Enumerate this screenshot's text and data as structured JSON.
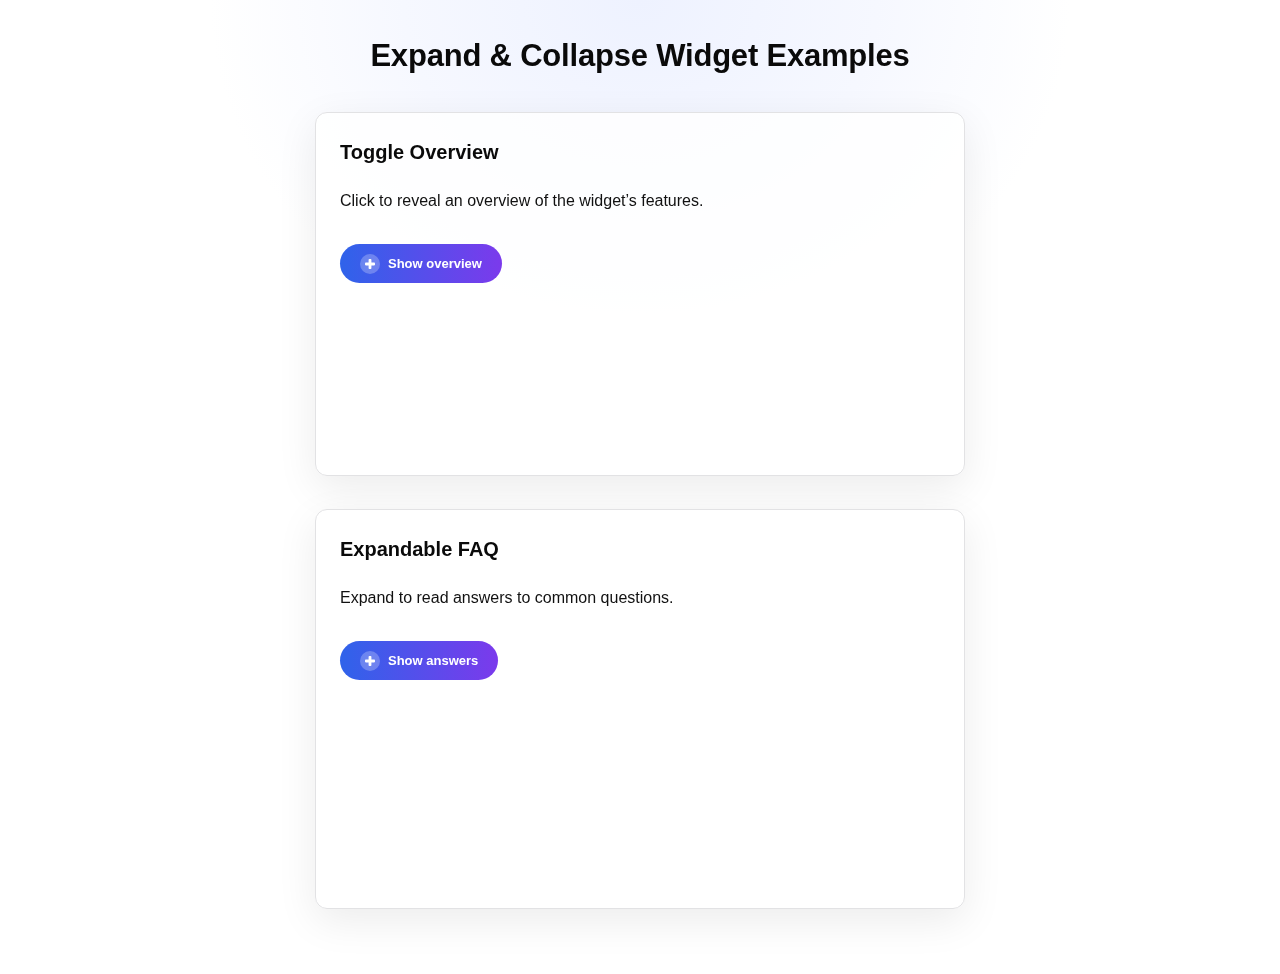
{
  "title": "Expand & Collapse Widget Examples",
  "widgets": [
    {
      "title": "Toggle Overview",
      "description": "Click to reveal an overview of the widget’s features.",
      "button": "Show overview",
      "expanded": false
    },
    {
      "title": "Expandable FAQ",
      "description": "Expand to read answers to common questions.",
      "button": "Show answers",
      "expanded": false
    }
  ]
}
